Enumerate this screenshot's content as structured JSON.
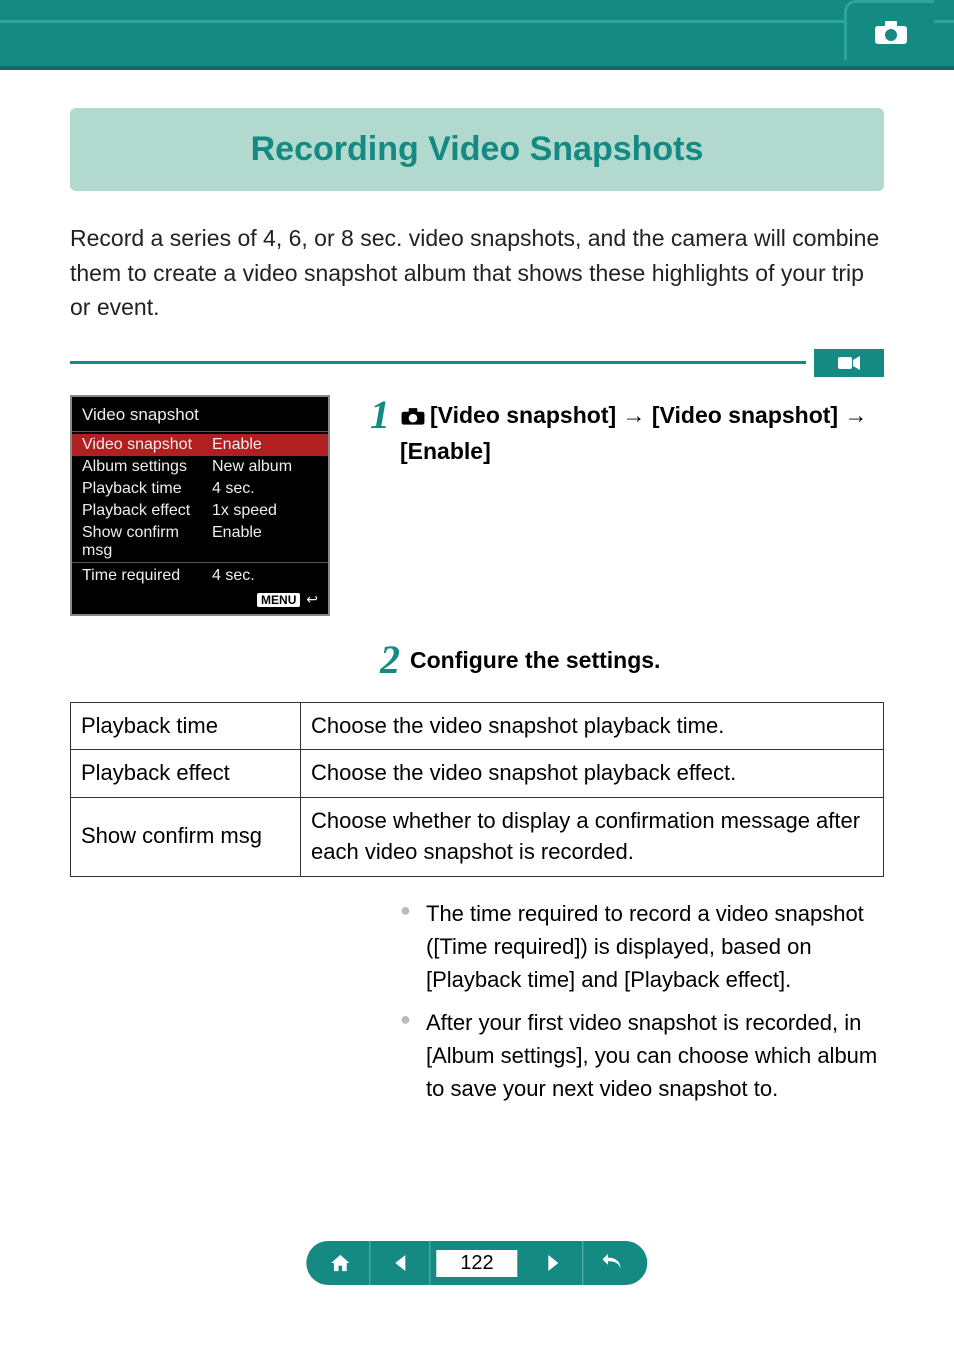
{
  "header": {
    "tab_icon": "camera-icon"
  },
  "title": "Recording Video Snapshots",
  "intro": "Record a series of 4, 6, or 8 sec. video snapshots, and the camera will combine them to create a video snapshot album that shows these highlights of your trip or event.",
  "mode_badge_icon": "movie-icon",
  "lcd": {
    "title": "Video snapshot",
    "rows": [
      {
        "label": "Video snapshot",
        "value": "Enable",
        "selected": true
      },
      {
        "label": "Album settings",
        "value": "New album",
        "selected": false
      },
      {
        "label": "Playback time",
        "value": "4 sec.",
        "selected": false
      },
      {
        "label": "Playback effect",
        "value": "1x speed",
        "selected": false
      },
      {
        "label": "Show confirm msg",
        "value": "Enable",
        "selected": false
      },
      {
        "label": "Time required",
        "value": "4 sec.",
        "selected": false
      }
    ],
    "footer_label": "MENU",
    "footer_icon": "return-icon"
  },
  "steps": {
    "s1": {
      "num": "1",
      "text": "[Video snapshot] → [Video snapshot] → [Enable]"
    },
    "s2": {
      "num": "2",
      "text": "Configure the settings."
    }
  },
  "table": [
    {
      "setting": "Playback time",
      "desc": "Choose the video snapshot playback time."
    },
    {
      "setting": "Playback effect",
      "desc": "Choose the video snapshot playback effect."
    },
    {
      "setting": "Show confirm msg",
      "desc": "Choose whether to display a confirmation message after each video snapshot is recorded."
    }
  ],
  "bullets": [
    "The time required to record a video snapshot ([Time required]) is displayed, based on [Playback time] and [Playback effect].",
    "After your first video snapshot is recorded, in [Album settings], you can choose which album to save your next video snapshot to."
  ],
  "nav": {
    "home_icon": "home-icon",
    "prev_icon": "prev-icon",
    "page": "122",
    "next_icon": "next-icon",
    "back_icon": "undo-icon"
  }
}
